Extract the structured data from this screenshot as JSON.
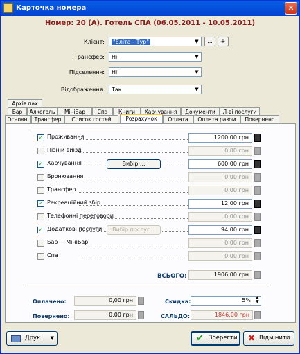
{
  "window": {
    "title": "Карточка номера"
  },
  "header": {
    "text": "Номер: 20 (А). Готель СПА (06.05.2011 - 10.05.2011)"
  },
  "fields": {
    "client": {
      "label": "Клієнт:",
      "value": "\"Еліта - Тур\""
    },
    "transfer": {
      "label": "Трансфер:",
      "value": "Ні"
    },
    "settlement": {
      "label": "Підселення:",
      "value": "Ні"
    },
    "display": {
      "label": "Відображення:",
      "value": "Так"
    },
    "client_buttons": {
      "dots": "...",
      "plus": "+"
    }
  },
  "tabs": {
    "row1": [
      "Архів пах"
    ],
    "row2": [
      "Бар",
      "Алкоголь",
      "МініБар",
      "Спа",
      "Книги",
      "Харчування",
      "Документи",
      "Л-ві послуги"
    ],
    "row3": [
      "Основні",
      "Трансфер",
      "Список гостей",
      "Розрахунок",
      "Оплата",
      "Оплата разом",
      "Повернено"
    ],
    "active": "Розрахунок"
  },
  "items": [
    {
      "label": "Проживання",
      "checked": true,
      "amount": "1200,00 грн"
    },
    {
      "label": "Пізній виїзд",
      "checked": false,
      "amount": "0,00 грн"
    },
    {
      "label": "Харчування",
      "checked": true,
      "amount": "600,00 грн",
      "button": "Вибір ..."
    },
    {
      "label": "Бронювання",
      "checked": false,
      "amount": "0,00 грн"
    },
    {
      "label": "Трансфер",
      "checked": false,
      "amount": "0,00 грн"
    },
    {
      "label": "Рекреаційний збір",
      "checked": true,
      "amount": "12,00 грн"
    },
    {
      "label": "Телефонні переговори",
      "checked": false,
      "amount": "0,00 грн"
    },
    {
      "label": "Додаткові послуги",
      "checked": true,
      "amount": "94,00 грн",
      "button": "Вибір послуг..."
    },
    {
      "label": "Бар + МініБар",
      "checked": false,
      "amount": "0,00 грн"
    },
    {
      "label": "Спа",
      "checked": false,
      "amount": "0,00 грн"
    }
  ],
  "total": {
    "label": "ВСЬОГО:",
    "value": "1906,00 грн"
  },
  "summary": {
    "paid_label": "Оплачено:",
    "paid": "0,00 грн",
    "returned_label": "Повернено:",
    "returned": "0,00 грн",
    "discount_label": "Скидка:",
    "discount": "5%",
    "balance_label": "САЛЬДО:",
    "balance": "1846,00 грн"
  },
  "footer": {
    "print": "Друк",
    "save": "Зберегти",
    "cancel": "Відмінити"
  },
  "colors": {
    "balance": "#c0392b",
    "header": "#8b1a1a"
  }
}
